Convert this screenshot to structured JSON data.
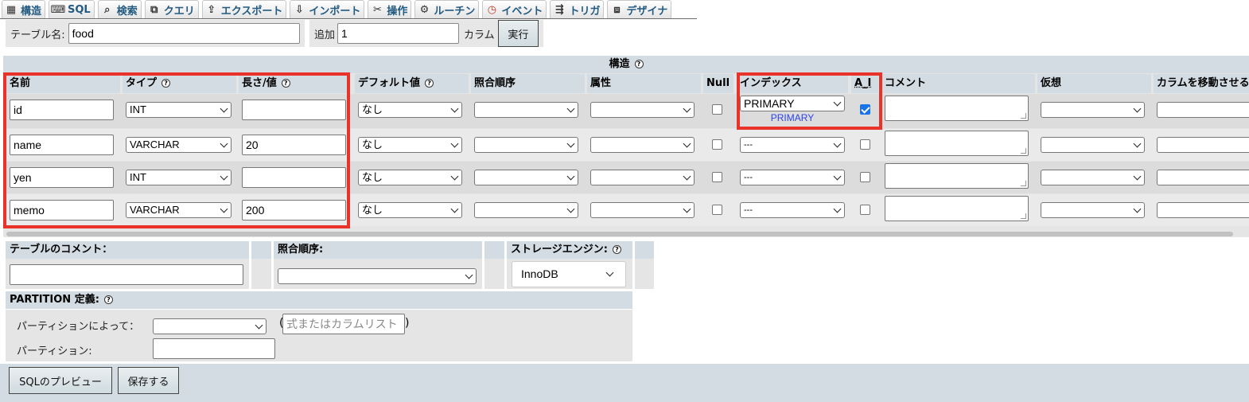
{
  "tabs": [
    {
      "label": "構造",
      "icon": "structure-icon"
    },
    {
      "label": "SQL",
      "icon": "sql-icon"
    },
    {
      "label": "検索",
      "icon": "search-icon"
    },
    {
      "label": "クエリ",
      "icon": "query-icon"
    },
    {
      "label": "エクスポート",
      "icon": "export-icon"
    },
    {
      "label": "インポート",
      "icon": "import-icon"
    },
    {
      "label": "操作",
      "icon": "operations-icon"
    },
    {
      "label": "ルーチン",
      "icon": "routines-icon"
    },
    {
      "label": "イベント",
      "icon": "events-icon"
    },
    {
      "label": "トリガ",
      "icon": "triggers-icon"
    },
    {
      "label": "デザイナ",
      "icon": "designer-icon"
    }
  ],
  "table_name": {
    "label": "テーブル名:",
    "value": "food"
  },
  "add_columns": {
    "label": "追加",
    "value": "1",
    "unit": "カラム",
    "button": "実行"
  },
  "structure": {
    "title": "構造",
    "headers": {
      "name": "名前",
      "type": "タイプ",
      "length": "長さ/値",
      "default": "デフォルト値",
      "collation": "照合順序",
      "attributes": "属性",
      "null": "Null",
      "index": "インデックス",
      "ai": "A_I",
      "comment": "コメント",
      "virtual": "仮想",
      "move": "カラムを移動させる"
    },
    "rows": [
      {
        "name": "id",
        "type": "INT",
        "length": "",
        "default": "なし",
        "index": "PRIMARY",
        "index_note": "PRIMARY",
        "ai": true,
        "null": false
      },
      {
        "name": "name",
        "type": "VARCHAR",
        "length": "20",
        "default": "なし",
        "index": "---",
        "index_note": "",
        "ai": false,
        "null": false
      },
      {
        "name": "yen",
        "type": "INT",
        "length": "",
        "default": "なし",
        "index": "---",
        "index_note": "",
        "ai": false,
        "null": false
      },
      {
        "name": "memo",
        "type": "VARCHAR",
        "length": "200",
        "default": "なし",
        "index": "---",
        "index_note": "",
        "ai": false,
        "null": false
      }
    ]
  },
  "table_comment": {
    "label": "テーブルのコメント："
  },
  "collation": {
    "label": "照合順序:"
  },
  "storage_engine": {
    "label": "ストレージエンジン:",
    "value": "InnoDB"
  },
  "partition": {
    "label": "PARTITION 定義:",
    "by_label": "パーティションによって：",
    "expr_placeholder": "式またはカラムリスト",
    "partitions_label": "パーティション:"
  },
  "footer": {
    "preview_button": "SQLのプレビュー",
    "save_button": "保存する"
  },
  "colors": {
    "highlight": "#e8322a",
    "header_bg": "#d3dce3",
    "tab_text": "#235a81",
    "primary_note": "#2b44e8"
  }
}
